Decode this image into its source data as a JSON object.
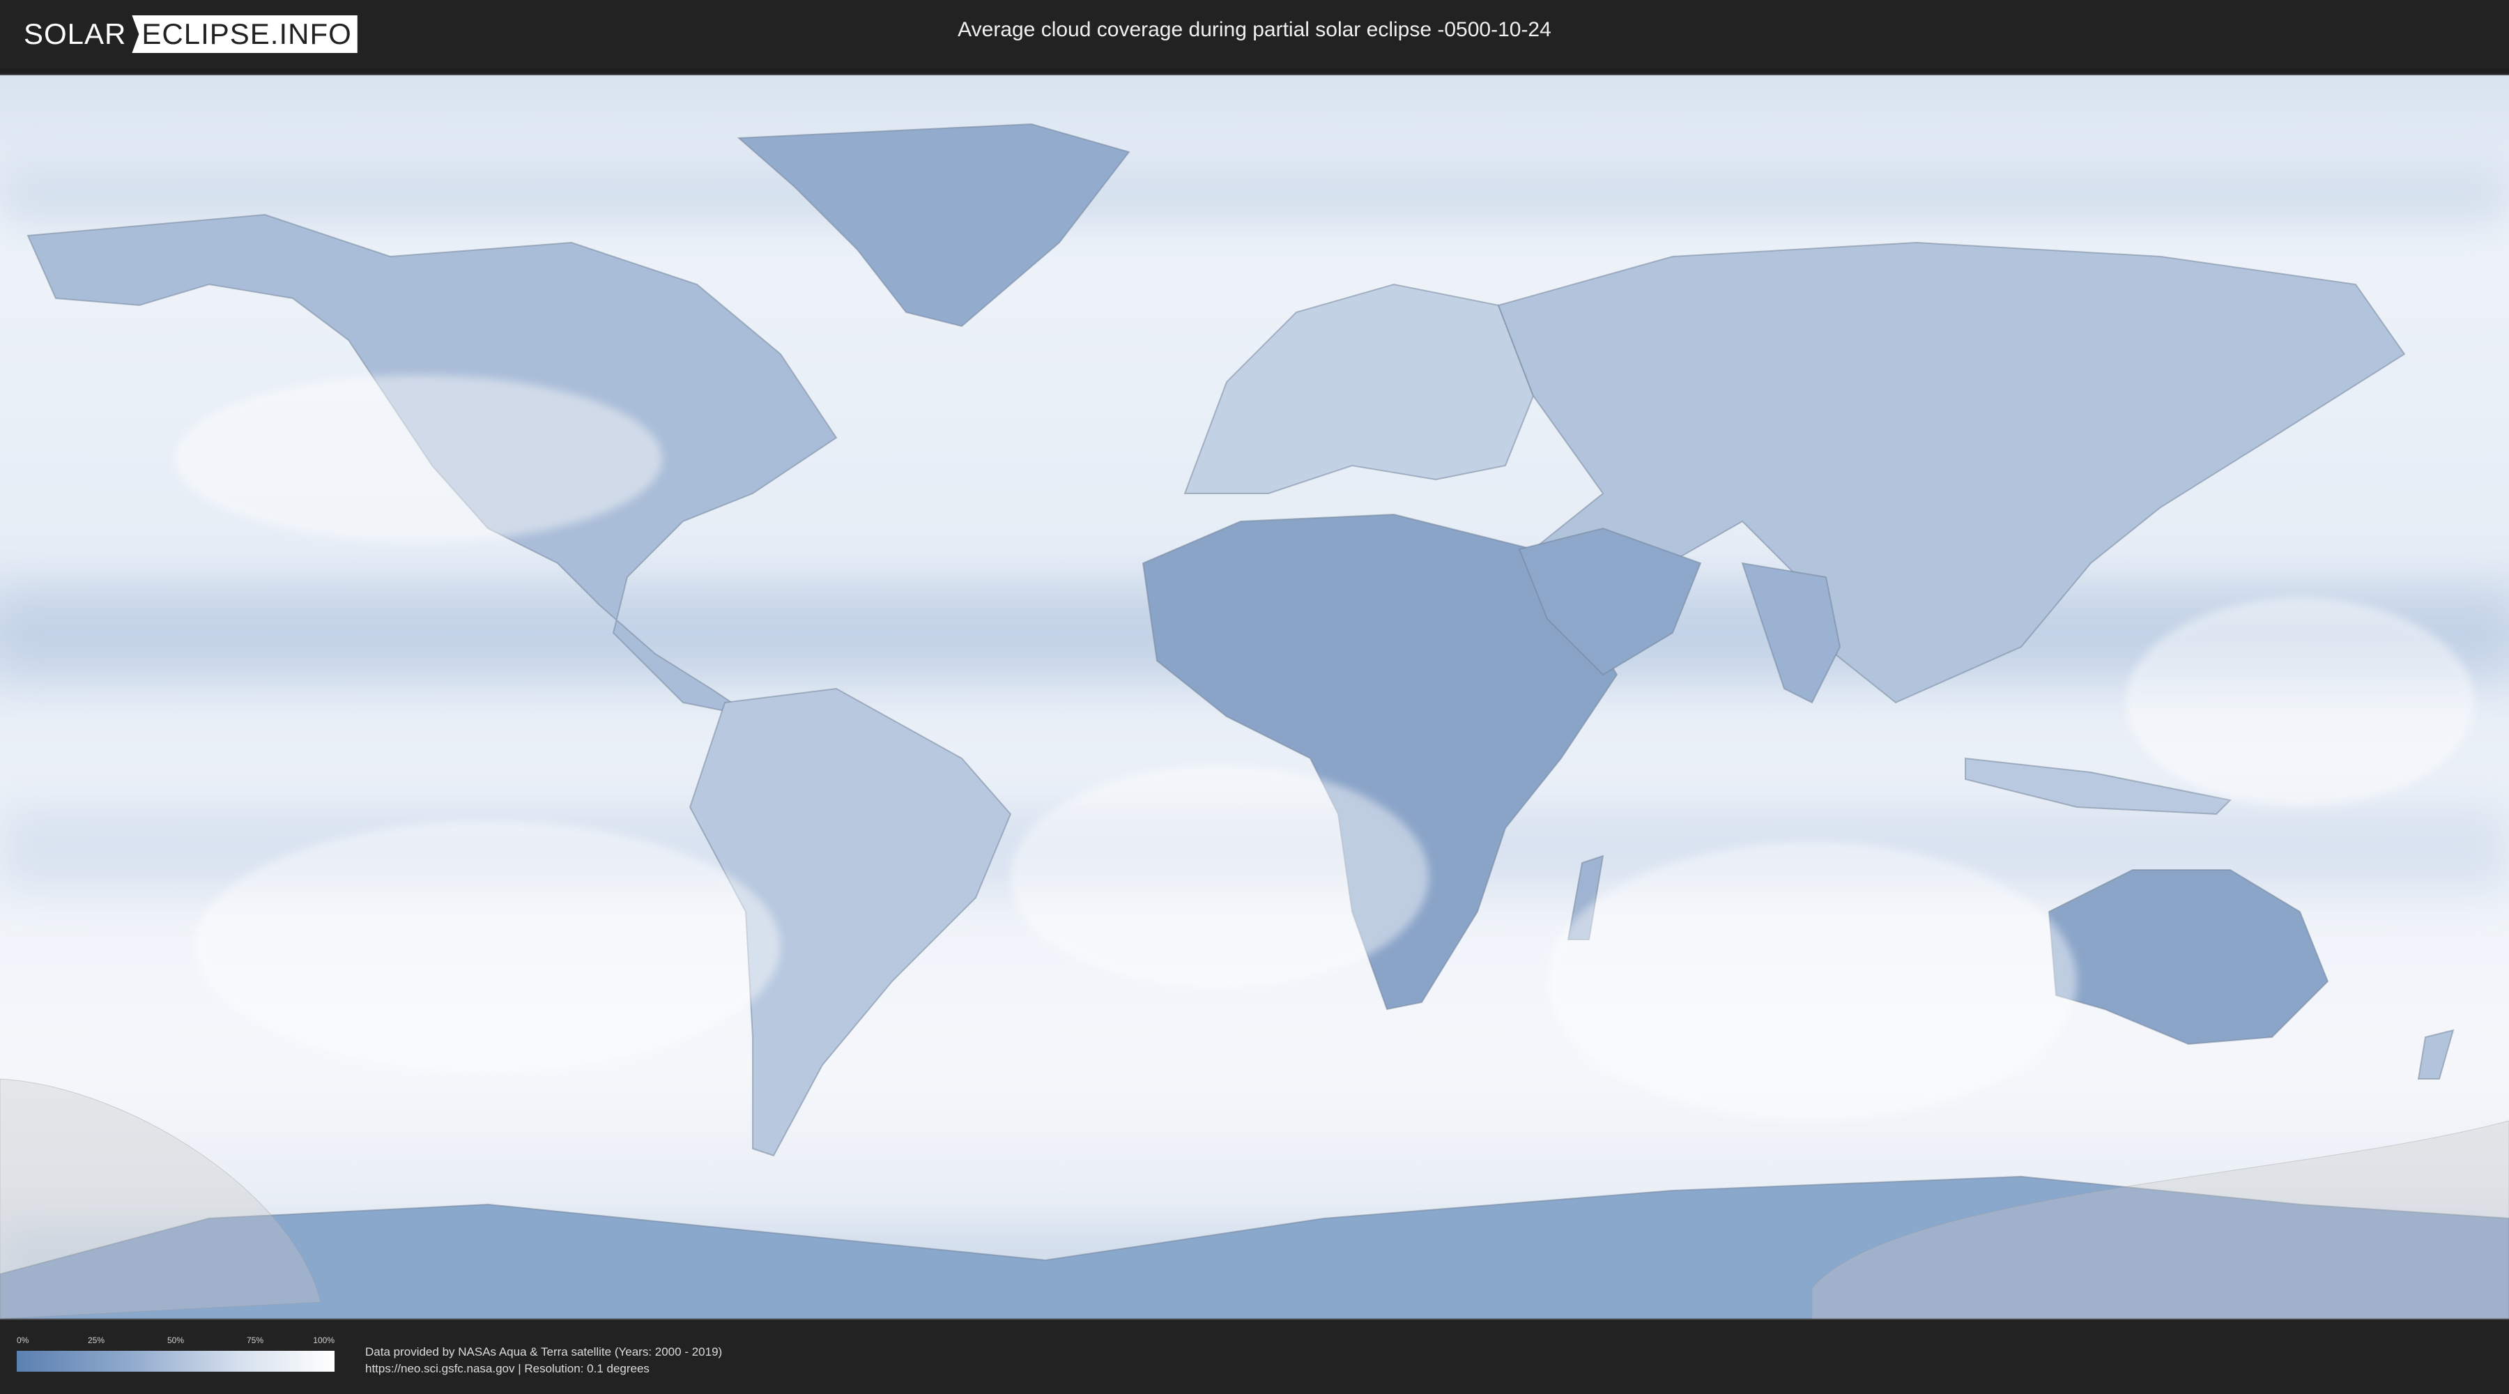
{
  "logo": {
    "part1": "SOLAR",
    "part2": "ECLIPSE.INFO"
  },
  "title": "Average cloud coverage during partial solar eclipse -0500-10-24",
  "legend": {
    "ticks": [
      "0%",
      "25%",
      "50%",
      "75%",
      "100%"
    ],
    "colors": {
      "low": "#5b80b2",
      "high": "#ffffff"
    }
  },
  "credits": {
    "line1": "Data provided by NASAs Aqua & Terra satellite (Years: 2000 - 2019)",
    "line2": "https://neo.sci.gsfc.nasa.gov | Resolution: 0.1 degrees"
  },
  "map": {
    "projection": "equirectangular",
    "layer": "average-cloud-coverage",
    "eclipse_zone_color": "#c9c9c9"
  }
}
